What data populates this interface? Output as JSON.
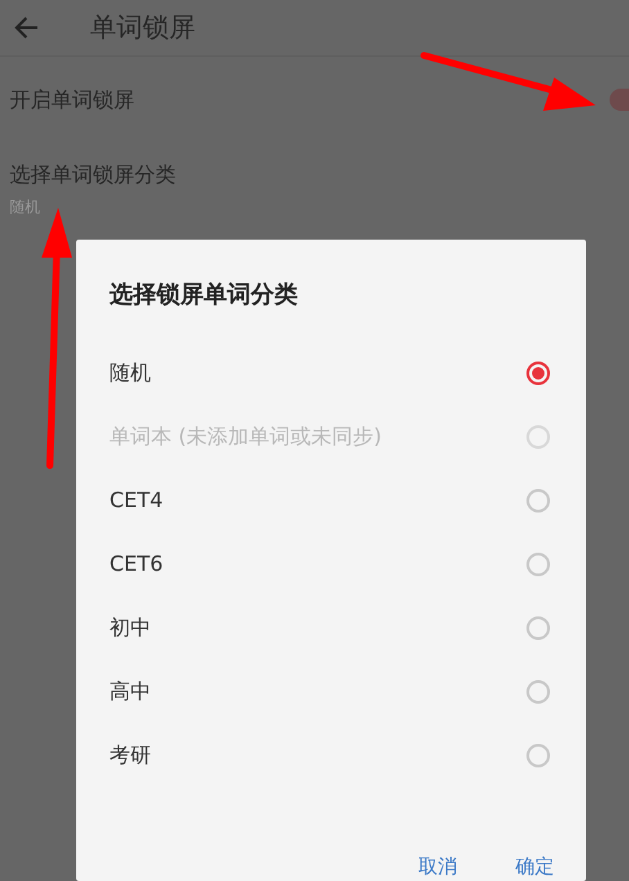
{
  "header": {
    "title": "单词锁屏"
  },
  "settings": [
    {
      "kind": "toggle",
      "label": "开启单词锁屏",
      "on": true
    },
    {
      "kind": "choice",
      "label": "选择单词锁屏分类",
      "value": "随机"
    }
  ],
  "dialog": {
    "title": "选择锁屏单词分类",
    "options": [
      {
        "label": "随机",
        "selected": true,
        "disabled": false
      },
      {
        "label": "单词本 (未添加单词或未同步)",
        "selected": false,
        "disabled": true
      },
      {
        "label": "CET4",
        "selected": false,
        "disabled": false
      },
      {
        "label": "CET6",
        "selected": false,
        "disabled": false
      },
      {
        "label": "初中",
        "selected": false,
        "disabled": false
      },
      {
        "label": "高中",
        "selected": false,
        "disabled": false
      },
      {
        "label": "考研",
        "selected": false,
        "disabled": false
      }
    ],
    "buttons": [
      "取消",
      "确定"
    ]
  }
}
